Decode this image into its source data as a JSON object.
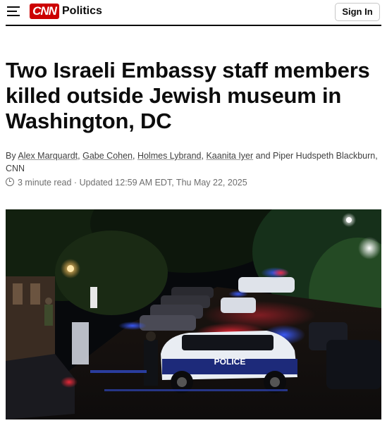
{
  "header": {
    "logo_text": "CNN",
    "section_label": "Politics",
    "sign_in_label": "Sign In"
  },
  "article": {
    "headline": "Two Israeli Embassy staff members killed outside Jewish museum in Washington, DC",
    "byline": {
      "prefix": "By",
      "authors_linked": [
        "Alex Marquardt",
        "Gabe Cohen",
        "Holmes Lybrand",
        "Kaanita Iyer"
      ],
      "and_word": "and",
      "last_author": "Piper Hudspeth Blackburn",
      "outlet": "CNN"
    },
    "read_time": "3 minute read",
    "separator": "·",
    "updated": "Updated 12:59 AM EDT, Thu May 22, 2025"
  },
  "photo": {
    "police_car_text": "POLICE",
    "colors": {
      "siren_red": "#ff2a3a",
      "siren_blue": "#3b5bff",
      "streetlight": "#ffb347"
    }
  },
  "colors": {
    "brand": "#cc0000",
    "text": "#0c0c0c",
    "meta": "#6e6e6e"
  }
}
